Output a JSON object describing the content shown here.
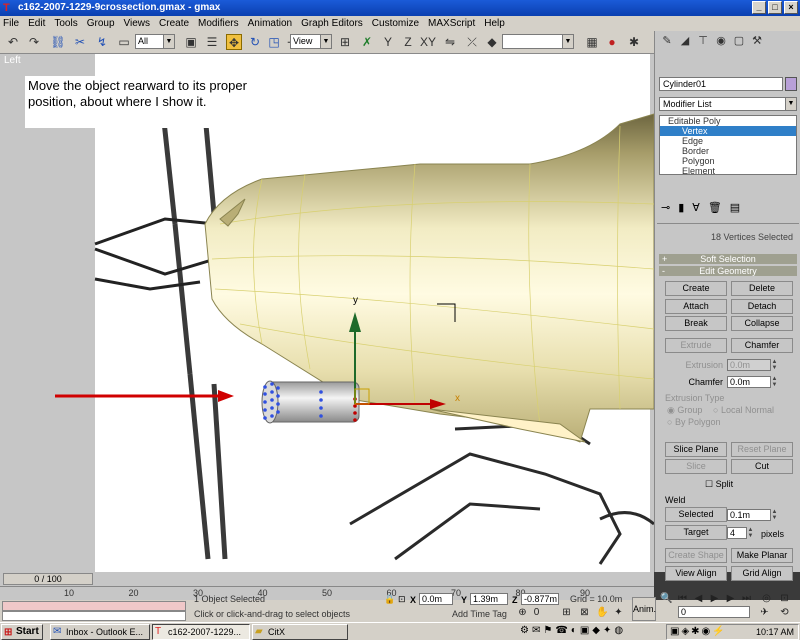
{
  "window": {
    "title": "c162-2007-1229-9crossection.gmax - gmax",
    "icon": "gmax-logo-icon"
  },
  "menu": [
    "File",
    "Edit",
    "Tools",
    "Group",
    "Views",
    "Create",
    "Modifiers",
    "Animation",
    "Graph Editors",
    "Customize",
    "MAXScript",
    "Help"
  ],
  "toolbar": {
    "selection_filter": "All",
    "ref_coord": "View",
    "named_selection": ""
  },
  "viewport": {
    "label": "Left",
    "annotation": "Move the object rearward to its proper position, about where I show it.",
    "gizmo_y_label": "y",
    "gizmo_x_label": "x",
    "accent": "#d00000"
  },
  "command_panel": {
    "object_name": "Cylinder01",
    "object_color": "#b8a0d8",
    "modifier_list": "Modifier List",
    "stack": [
      {
        "label": "Editable Poly",
        "level": 0,
        "selected": false
      },
      {
        "label": "Vertex",
        "level": 1,
        "selected": true
      },
      {
        "label": "Edge",
        "level": 1,
        "selected": false
      },
      {
        "label": "Border",
        "level": 1,
        "selected": false
      },
      {
        "label": "Polygon",
        "level": 1,
        "selected": false
      },
      {
        "label": "Element",
        "level": 1,
        "selected": false
      }
    ],
    "selection_info": "18 Vertices Selected",
    "soft_selection": "Soft Selection",
    "edit_geometry": "Edit Geometry",
    "buttons": {
      "create": "Create",
      "delete": "Delete",
      "attach": "Attach",
      "detach": "Detach",
      "break": "Break",
      "collapse": "Collapse",
      "extrude": "Extrude",
      "chamfer": "Chamfer",
      "slice_plane": "Slice Plane",
      "reset_plane": "Reset Plane",
      "slice": "Slice",
      "cut": "Cut",
      "split": "Split",
      "selected": "Selected",
      "target": "Target",
      "create_shape": "Create Shape",
      "make_planar": "Make Planar",
      "view_align": "View Align",
      "grid_align": "Grid Align"
    },
    "extrusion_label": "Extrusion",
    "extrusion_value": "0.0m",
    "chamfer_label": "Chamfer",
    "chamfer_value": "0.0m",
    "extrusion_type": "Extrusion Type",
    "radio_group": "Group",
    "radio_local": "Local Normal",
    "radio_polygon": "By Polygon",
    "weld_label": "Weld",
    "weld_selected_value": "0.1m",
    "weld_target_value": "4",
    "weld_target_unit": "pixels"
  },
  "timeline": {
    "frame_display": "0 / 100",
    "ticks": [
      "10",
      "20",
      "30",
      "40",
      "50",
      "60",
      "70",
      "80",
      "90"
    ]
  },
  "status": {
    "selection": "1 Object Selected",
    "prompt": "Click or click-and-drag to select objects",
    "x_label": "X",
    "x_value": "0.0m",
    "y_label": "Y",
    "y_value": "1.39m",
    "z_label": "Z",
    "z_value": "-0.877m",
    "grid": "Grid = 10.0m",
    "add_time_tag": "Add Time Tag",
    "frame_value": "0",
    "anim": "Anim."
  },
  "taskbar": {
    "start": "Start",
    "tasks": [
      {
        "label": "Inbox - Outlook E...",
        "icon": "outlook-icon",
        "active": false
      },
      {
        "label": "c162-2007-1229...",
        "icon": "gmax-logo-icon",
        "active": true
      },
      {
        "label": "CitX",
        "icon": "folder-icon",
        "active": false
      }
    ],
    "clock": "10:17 AM"
  }
}
